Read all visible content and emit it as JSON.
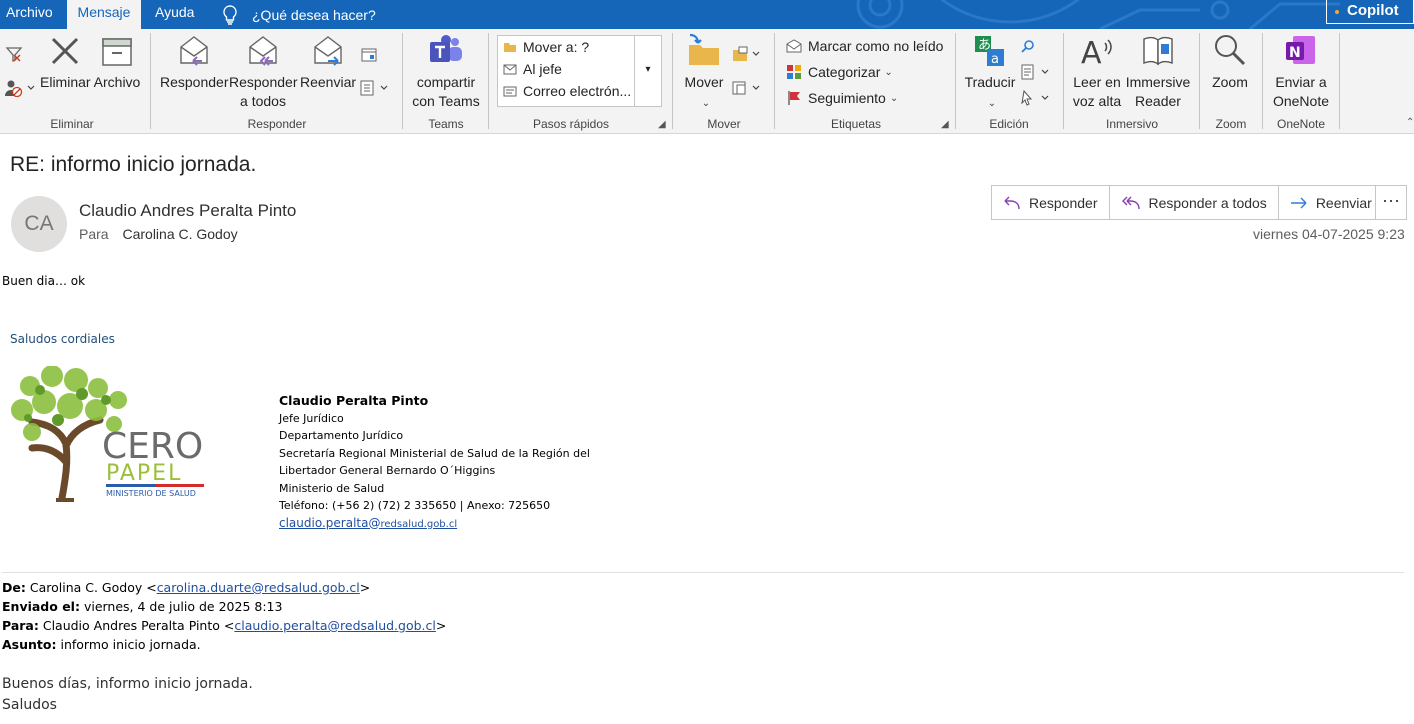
{
  "tabs": {
    "archivo": "Archivo",
    "mensaje": "Mensaje",
    "ayuda": "Ayuda",
    "tell_me": "¿Qué desea hacer?",
    "copilot": "Copilot"
  },
  "ribbon": {
    "eliminar": {
      "delete": "Eliminar",
      "archive": "Archivo",
      "group": "Eliminar"
    },
    "responder": {
      "reply": "Responder",
      "reply_all_1": "Responder",
      "reply_all_2": "a todos",
      "forward": "Reenviar",
      "group": "Responder"
    },
    "teams": {
      "share_1": "compartir",
      "share_2": "con Teams",
      "group": "Teams"
    },
    "quick_steps": {
      "items": [
        "Mover a: ?",
        "Al jefe",
        "Correo electrón..."
      ],
      "group": "Pasos rápidos"
    },
    "mover": {
      "move": "Mover",
      "group": "Mover"
    },
    "etiquetas": {
      "mark_unread": "Marcar como no leído",
      "categorize": "Categorizar",
      "follow_up": "Seguimiento",
      "group": "Etiquetas"
    },
    "edicion": {
      "translate": "Traducir",
      "group": "Edición"
    },
    "inmersivo": {
      "read_aloud_1": "Leer en",
      "read_aloud_2": "voz alta",
      "immersive_1": "Immersive",
      "immersive_2": "Reader",
      "group": "Inmersivo"
    },
    "zoom": {
      "zoom": "Zoom",
      "group": "Zoom"
    },
    "onenote": {
      "send_1": "Enviar a",
      "send_2": "OneNote",
      "group": "OneNote"
    }
  },
  "message": {
    "subject": "RE: informo inicio jornada.",
    "avatar_initials": "CA",
    "sender": "Claudio Andres Peralta Pinto",
    "to_label": "Para",
    "to": "Carolina C. Godoy",
    "date": "viernes 04-07-2025 9:23",
    "actions": {
      "reply": "Responder",
      "reply_all": "Responder a todos",
      "forward": "Reenviar",
      "more": "···"
    }
  },
  "body": {
    "greeting": "Buen dia… ok",
    "closing": "Saludos cordiales",
    "signature": {
      "name": "Claudio Peralta Pinto",
      "title": "Jefe Jurídico",
      "department": "Departamento Jurídico",
      "org_line1": "Secretaría Regional Ministerial de Salud de la Región del",
      "org_line2": "Libertador General Bernardo O´Higgins",
      "ministry": "Ministerio de Salud",
      "phone": "Teléfono: (+56 2) (72) 2 335650 | Anexo: 725650",
      "email_user": "claudio.peralta@",
      "email_domain": "redsalud.gob.cl"
    },
    "logo": {
      "line1": "CERO",
      "line2": "PAPEL",
      "line3": "MINISTERIO DE SALUD"
    },
    "quoted": {
      "from_label": "De:",
      "from_name": "Carolina C. Godoy <",
      "from_email": "carolina.duarte@redsalud.gob.cl",
      "from_end": ">",
      "sent_label": "Enviado el:",
      "sent": "viernes, 4 de julio de 2025 8:13",
      "to_label": "Para:",
      "to_name": "Claudio Andres Peralta Pinto <",
      "to_email": "claudio.peralta@redsalud.gob.cl",
      "to_end": ">",
      "subject_label": "Asunto:",
      "subject": "informo inicio jornada.",
      "line1": "Buenos días,  informo inicio jornada.",
      "line2": "Saludos"
    }
  }
}
